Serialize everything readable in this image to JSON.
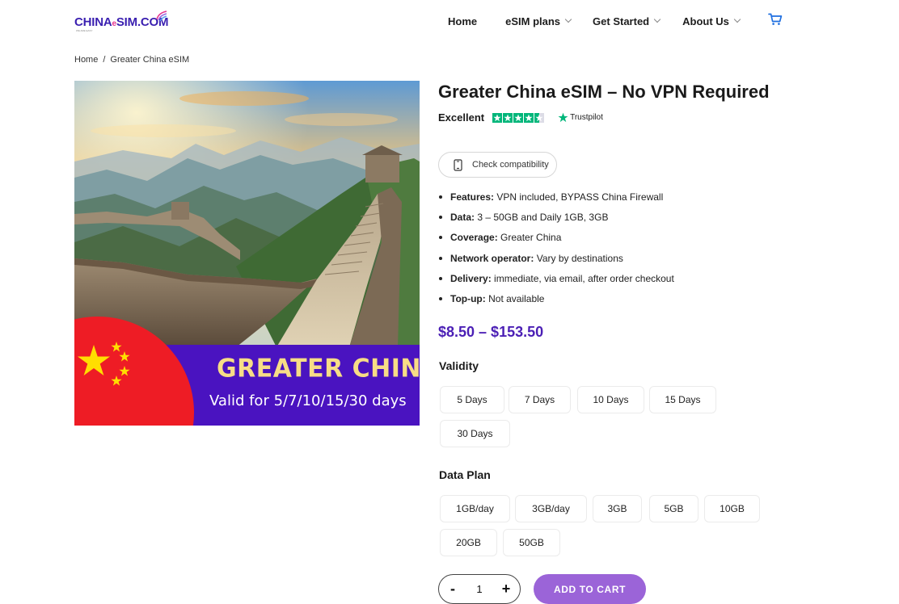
{
  "brand": {
    "logo_main": "CHINA",
    "logo_e": "e",
    "logo_rest": "SIM.COM",
    "logo_tag": "WE ARE EASY",
    "accent": "#3a1fb0",
    "pink": "#e6358f"
  },
  "nav": {
    "items": [
      {
        "label": "Home",
        "has_dropdown": false
      },
      {
        "label": "eSIM plans",
        "has_dropdown": true
      },
      {
        "label": "Get Started",
        "has_dropdown": true
      },
      {
        "label": "About Us",
        "has_dropdown": true
      }
    ],
    "cart_icon": "cart-icon"
  },
  "breadcrumb": {
    "items": [
      "Home",
      "Greater China eSIM"
    ],
    "separator": "/"
  },
  "product_image": {
    "title": "GREATER CHINA",
    "subtitle": "Valid for 5/7/10/15/30 days",
    "banner_color": "#4a13c0",
    "flag_color": "#ee1c25"
  },
  "product": {
    "title": "Greater China eSIM – No VPN Required",
    "rating_label": "Excellent",
    "rating_stars": 4.5,
    "trustpilot": "Trustpilot",
    "compat_label": "Check compatibility",
    "features": [
      {
        "label": "Features:",
        "value": "VPN included, BYPASS China Firewall"
      },
      {
        "label": "Data:",
        "value": "3 – 50GB and Daily 1GB, 3GB"
      },
      {
        "label": "Coverage:",
        "value": "Greater China"
      },
      {
        "label": "Network operator:",
        "value": "Vary by destinations"
      },
      {
        "label": "Delivery:",
        "value": "immediate, via email, after order checkout"
      },
      {
        "label": "Top-up:",
        "value": "Not available"
      }
    ],
    "price": "$8.50 – $153.50",
    "price_color": "#4b1fb5"
  },
  "validity": {
    "label": "Validity",
    "options": [
      "5 Days",
      "7 Days",
      "10 Days",
      "15 Days",
      "30 Days"
    ]
  },
  "data_plan": {
    "label": "Data Plan",
    "options": [
      "1GB/day",
      "3GB/day",
      "3GB",
      "5GB",
      "10GB",
      "20GB",
      "50GB"
    ]
  },
  "cart": {
    "minus": "-",
    "quantity": "1",
    "plus": "+",
    "add_label": "ADD TO CART",
    "button_color": "#9b64d8"
  }
}
